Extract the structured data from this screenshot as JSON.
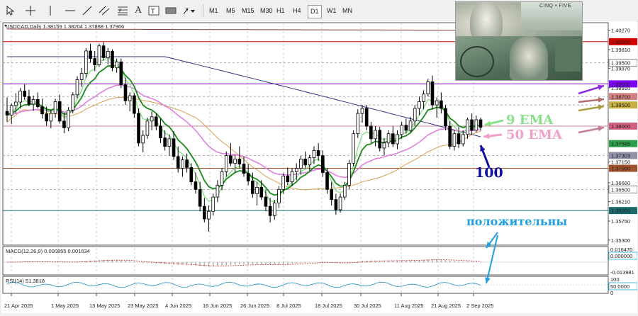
{
  "toolbar": {
    "timeframes": [
      "M1",
      "M5",
      "M15",
      "M30",
      "H1",
      "H4",
      "D1",
      "W1",
      "MN"
    ],
    "active_timeframe": "D1"
  },
  "main": {
    "header": "USDCAD,Daily  1.38159 1.38204 1.37898 1.37966"
  },
  "price_axis": {
    "labels": [
      {
        "text": "1.40270",
        "price": 1.4027,
        "hl": null
      },
      {
        "text": "1.40000",
        "price": 1.4,
        "hl": "#d40000"
      },
      {
        "text": "1.39810",
        "price": 1.3981,
        "hl": null
      },
      {
        "text": "1.39500",
        "price": 1.395,
        "hl": "#ffffff"
      },
      {
        "text": "1.39370",
        "price": 1.3937,
        "hl": null
      },
      {
        "text": "1.39000",
        "price": 1.39,
        "hl": "#8000ff"
      },
      {
        "text": "1.38910",
        "price": 1.3891,
        "hl": null
      },
      {
        "text": "1.38700",
        "price": 1.387,
        "hl": "#d08080"
      },
      {
        "text": "1.38500",
        "price": 1.385,
        "hl": "#c8b040"
      },
      {
        "text": "1.38000",
        "price": 1.38,
        "hl": "#d06080"
      },
      {
        "text": "1.37585",
        "price": 1.37585,
        "hl": "#2aa04a"
      },
      {
        "text": "1.37303",
        "price": 1.37303,
        "hl": "#9090a8"
      },
      {
        "text": "1.37150",
        "price": 1.3715,
        "hl": null
      },
      {
        "text": "1.37000",
        "price": 1.37,
        "hl": "#a0522d"
      },
      {
        "text": "1.36660",
        "price": 1.3666,
        "hl": null
      },
      {
        "text": "1.36500",
        "price": 1.365,
        "hl": "#ffffff"
      },
      {
        "text": "1.36210",
        "price": 1.3621,
        "hl": null
      },
      {
        "text": "1.36000",
        "price": 1.36,
        "hl": "#1a6b6b"
      },
      {
        "text": "1.35750",
        "price": 1.3575,
        "hl": null
      },
      {
        "text": "1.35300",
        "price": 1.353,
        "hl": null
      }
    ]
  },
  "date_axis": [
    "21 Apr 2025",
    "1 May 2025",
    "13 May 2025",
    "23 May 2025",
    "4 Jun 2025",
    "16 Jun 2025",
    "26 Jun 2025",
    "8 Jul 2025",
    "18 Jul 2025",
    "30 Jul 2025",
    "11 Aug 2025",
    "21 Aug 2025",
    "2 Sep 2025"
  ],
  "annotations": {
    "ema9": "9 EMA",
    "ema50": "50 EMA",
    "ma100": "100",
    "positive": "положительны"
  },
  "macd": {
    "header": "MACD(12,26,9) 0.000855 0.001634",
    "labels": [
      {
        "text": "0.016470",
        "hl": false
      },
      {
        "text": "0.000000",
        "hl": true
      },
      {
        "text": "-0.013981",
        "hl": false
      }
    ]
  },
  "rsi": {
    "header": "RSI(14) 51.3818",
    "labels": [
      {
        "text": "100",
        "hl": false
      },
      {
        "text": "50.0000",
        "hl": true
      },
      {
        "text": "0",
        "hl": false
      }
    ]
  },
  "colors": {
    "ema9": "#1a8a1a",
    "ema9_light": "#8ae08a",
    "ema50": "#e080e0",
    "ma100": "#303080",
    "ma200": "#8b3a3a",
    "orange_ma": "#d8a050",
    "bull": "#ffffff",
    "bear": "#000000",
    "annot_green": "#88e088",
    "annot_pink": "#f0a0c8",
    "annot_blue": "#1010a0",
    "annot_cyan": "#20a0e0"
  }
}
